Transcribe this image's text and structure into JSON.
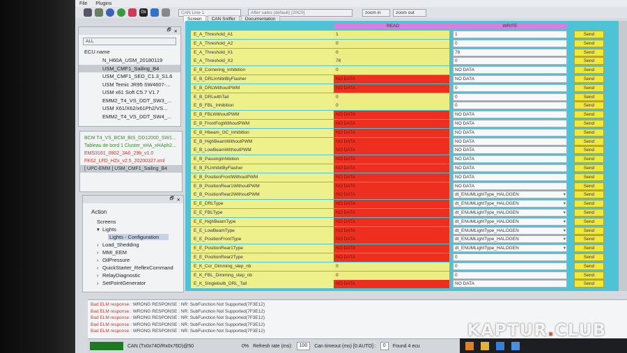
{
  "menu": [
    "File",
    "Plugins"
  ],
  "toolbar": {
    "can_line": "CAN Line 1",
    "market": "After sales (default) [20C0]",
    "zoom_in": "zoom in",
    "zoom_out": "zoom out",
    "icons": [
      "connect-icon",
      "settings-icon",
      "ecu-icon",
      "speed-icon",
      "health-icon",
      "hex-icon",
      "car-icon",
      "wrench-icon"
    ],
    "hex_label": "0x"
  },
  "tabs": [
    "Screen",
    "CAN Sniffer",
    "Documentation"
  ],
  "ecu_pane": {
    "filter": "ALL",
    "header": "ECU name",
    "items": [
      "N_H60A_USM_20180119",
      "USM_CMF1_Sailing_B4",
      "USM_CMF1_SED_C1.3_S1.6",
      "USM Temic JR95 SW4607-...",
      "USM x61 Soft C5.7 V1.7",
      "EMM2_T4_VS_DDT_SW3_...",
      "USM X61/X62/x61Ph2/VS...",
      "EMM2_T4_VS_DDT_SW4_..."
    ],
    "selected_index": 1
  },
  "loaded_pane": {
    "items": [
      {
        "text": "BCM T4_VS_BCM_BIS_DD12000_SW1...",
        "color": "#3a8a2a"
      },
      {
        "text": "Tableau de bord 1 Cluster_xHA_xHAph2...",
        "color": "#3a8a2a"
      },
      {
        "text": "EMS3161_0902_3A0_29b_v1.0",
        "color": "#c0392b"
      },
      {
        "text": "FK62_LFD_HZx_v2.5_20200327.xml",
        "color": "#c0392b"
      },
      {
        "text": "[ UPC-EMM ] USM_CMF1_Sailing_B4",
        "color": "#333"
      }
    ]
  },
  "action_pane": {
    "header": "Action",
    "tree": [
      {
        "text": "Screens",
        "indent": 0,
        "arrow": ""
      },
      {
        "text": "Lights",
        "indent": 1,
        "arrow": "▾"
      },
      {
        "text": "Lights - Configuration",
        "indent": 2,
        "arrow": "",
        "selected": true
      },
      {
        "text": "Load_Shedding",
        "indent": 1,
        "arrow": "›"
      },
      {
        "text": "MMI_EEM",
        "indent": 1,
        "arrow": "›"
      },
      {
        "text": "OilPressure",
        "indent": 1,
        "arrow": "›"
      },
      {
        "text": "QuickStarter_ReflexCommand",
        "indent": 1,
        "arrow": "›"
      },
      {
        "text": "RelayDiagnostic",
        "indent": 1,
        "arrow": "›"
      },
      {
        "text": "SetPointGenerator",
        "indent": 1,
        "arrow": "›"
      }
    ]
  },
  "grid": {
    "read_header": "READ",
    "write_header": "WRITE",
    "send_label": "Send",
    "rows": [
      {
        "name": "E_A_Threshold_A1",
        "read": "1",
        "nd": false,
        "write": "1",
        "dd": false
      },
      {
        "name": "E_A_Threshold_A2",
        "read": "0",
        "nd": false,
        "write": "0",
        "dd": false
      },
      {
        "name": "E_A_Threshold_X1",
        "read": "0",
        "nd": false,
        "write": "78",
        "dd": false
      },
      {
        "name": "E_A_Threshold_X2",
        "read": "78",
        "nd": false,
        "write": "0",
        "dd": false
      },
      {
        "name": "E_B_Cornering_Inhibition",
        "read": "0",
        "nd": false,
        "write": "NO DATA",
        "dd": false
      },
      {
        "name": "E_B_DRLInhibitByFlasher",
        "read": "NO DATA",
        "nd": true,
        "write": "NO DATA",
        "dd": false
      },
      {
        "name": "E_B_DRLWithoutPWM",
        "read": "NO DATA",
        "nd": true,
        "write": "0",
        "dd": false
      },
      {
        "name": "E_B_DRLwithTail",
        "read": "0",
        "nd": false,
        "write": "0",
        "dd": false
      },
      {
        "name": "E_B_FBL_Inhibition",
        "read": "0",
        "nd": false,
        "write": "0",
        "dd": false
      },
      {
        "name": "E_B_FBLWithoutPWM",
        "read": "NO DATA",
        "nd": true,
        "write": "NO DATA",
        "dd": false
      },
      {
        "name": "E_B_FrontFogWithoutPWM",
        "read": "NO DATA",
        "nd": true,
        "write": "NO DATA",
        "dd": false
      },
      {
        "name": "E_B_Hbeam_OC_Inhibition",
        "read": "NO DATA",
        "nd": true,
        "write": "NO DATA",
        "dd": false
      },
      {
        "name": "E_B_HighBeamWithoutPWM",
        "read": "NO DATA",
        "nd": true,
        "write": "NO DATA",
        "dd": false
      },
      {
        "name": "E_B_LowBeamWithoutPWM",
        "read": "NO DATA",
        "nd": true,
        "write": "NO DATA",
        "dd": false
      },
      {
        "name": "E_B_PassingInhibition",
        "read": "NO DATA",
        "nd": true,
        "write": "NO DATA",
        "dd": false
      },
      {
        "name": "E_B_PLInhibitByFlasher",
        "read": "NO DATA",
        "nd": true,
        "write": "NO DATA",
        "dd": false
      },
      {
        "name": "E_B_PositionFrontWithoutPWM",
        "read": "NO DATA",
        "nd": true,
        "write": "NO DATA",
        "dd": false
      },
      {
        "name": "E_B_PositionRear1WithoutPWM",
        "read": "NO DATA",
        "nd": true,
        "write": "NO DATA",
        "dd": false
      },
      {
        "name": "E_B_PositionRear2WithoutPWM",
        "read": "NO DATA",
        "nd": true,
        "write": "dt_ENUMLightType_HALOGEN",
        "dd": true
      },
      {
        "name": "E_E_DRLType",
        "read": "NO DATA",
        "nd": true,
        "write": "dt_ENUMLightType_HALOGEN",
        "dd": true
      },
      {
        "name": "E_E_FBLType",
        "read": "NO DATA",
        "nd": true,
        "write": "dt_ENUMLightType_HALOGEN",
        "dd": true
      },
      {
        "name": "E_E_HighBeamType",
        "read": "NO DATA",
        "nd": true,
        "write": "dt_ENUMLightType_HALOGEN",
        "dd": true
      },
      {
        "name": "E_E_LowBeamType",
        "read": "NO DATA",
        "nd": true,
        "write": "dt_ENUMLightType_HALOGEN",
        "dd": true
      },
      {
        "name": "E_E_PositionFrontType",
        "read": "NO DATA",
        "nd": true,
        "write": "dt_ENUMLightType_HALOGEN",
        "dd": true
      },
      {
        "name": "E_E_PositionRear1Type",
        "read": "NO DATA",
        "nd": true,
        "write": "dt_ENUMLightType_HALOGEN",
        "dd": true
      },
      {
        "name": "E_E_PositionRear2Type",
        "read": "NO DATA",
        "nd": true,
        "write": "0",
        "dd": false
      },
      {
        "name": "E_K_Cor_Dimming_step_nb",
        "read": "0",
        "nd": false,
        "write": "0",
        "dd": false
      },
      {
        "name": "E_K_FBL_Dimming_step_nb",
        "read": "0",
        "nd": false,
        "write": "0",
        "dd": false
      },
      {
        "name": "E_K_Singlebulb_DRL_Tail",
        "read": "NO DATA",
        "nd": true,
        "write": "NO DATA",
        "dd": false
      }
    ]
  },
  "log": {
    "lines": [
      {
        "prefix": "Bad ELM response",
        "text": " : WRONG RESPONSE : NR: SubFunction Not Supported(7F3E12)"
      },
      {
        "prefix": "Bad ELM response",
        "text": " : WRONG RESPONSE : NR: SubFunction Not Supported(7F3E12)"
      },
      {
        "prefix": "Bad ELM response",
        "text": " : WRONG RESPONSE : NR: SubFunction Not Supported(7F3E12)"
      },
      {
        "prefix": "Bad ELM response",
        "text": " : WRONG RESPONSE : NR: SubFunction Not Supported(7F3E12)"
      },
      {
        "prefix": "Bad ELM response",
        "text": " : WRONG RESPONSE : NR: SubFunction Not Supported(7F3E12)"
      }
    ]
  },
  "status": {
    "can_info": "CAN (Tx0x74D/Rx0x76D)@50",
    "percent": "0%",
    "refresh_label": "Refresh rate (ms):",
    "refresh_value": "100",
    "timeout_label": "Can timeout (ms) [0:AUTO] :",
    "timeout_value": "0",
    "found": "Found 4 ecu"
  },
  "watermark": {
    "brand": "KAPTUR",
    "suffix": "CLUB"
  }
}
